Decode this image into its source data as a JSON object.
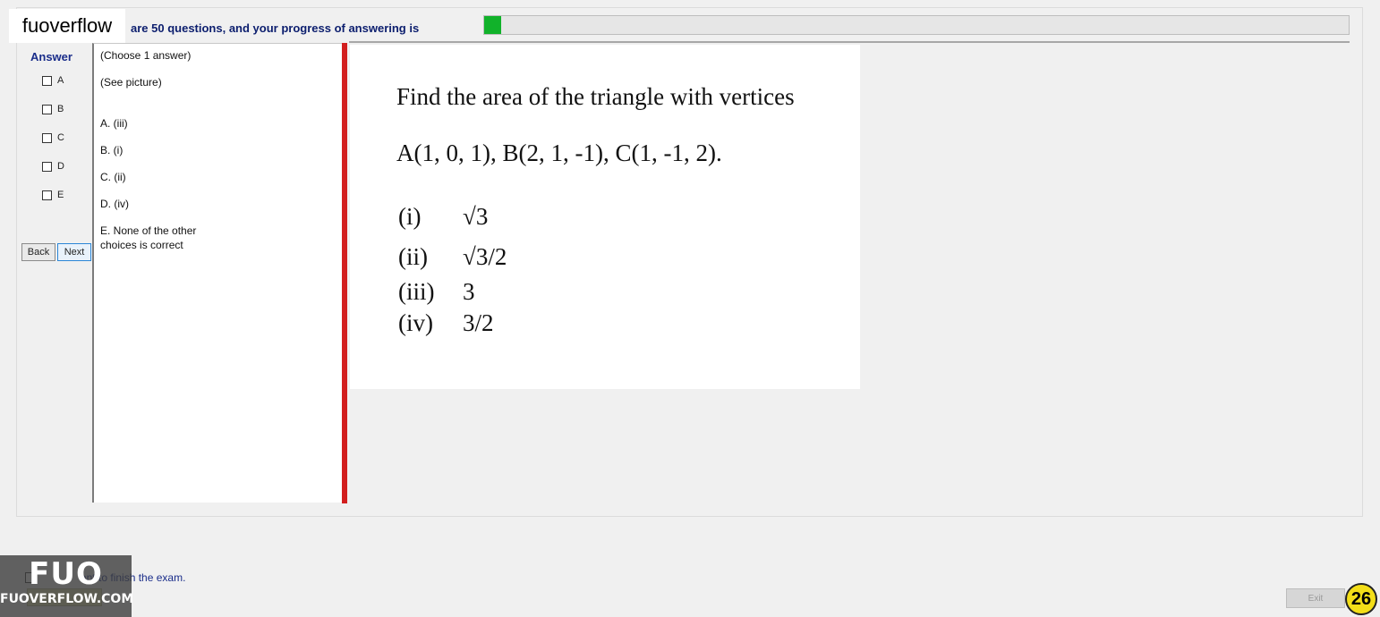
{
  "header": {
    "brand": "fuoverflow",
    "progress_text": "are 50 questions, and your progress of answering is",
    "progress_fraction": 0.02,
    "progress_color": "#11b22a"
  },
  "answer": {
    "title": "Answer",
    "options": [
      "A",
      "B",
      "C",
      "D",
      "E"
    ],
    "back_label": "Back",
    "next_label": "Next"
  },
  "question_text": {
    "instruction": "(Choose 1 answer)",
    "see_picture": "(See picture)",
    "choices": [
      "A. (iii)",
      "B. (i)",
      "C. (ii)",
      "D. (iv)"
    ],
    "choice_e_line1": "E. None of the other",
    "choice_e_line2": "choices is correct"
  },
  "question_image": {
    "line1": "Find the area of the triangle with vertices",
    "line2": "A(1, 0, 1), B(2, 1, -1), C(1, -1, 2).",
    "options": [
      {
        "label": "(i)",
        "value": "√3"
      },
      {
        "label": "(ii)",
        "value": "√3/2"
      },
      {
        "label": "(iii)",
        "value": "3"
      },
      {
        "label": "(iv)",
        "value": "3/2"
      }
    ]
  },
  "footer": {
    "finish_text": "ant to finish the exam.",
    "logo_big": "FUO",
    "logo_small": "FUOVERFLOW.COM",
    "exit_label": "Exit",
    "page_number": "26"
  }
}
